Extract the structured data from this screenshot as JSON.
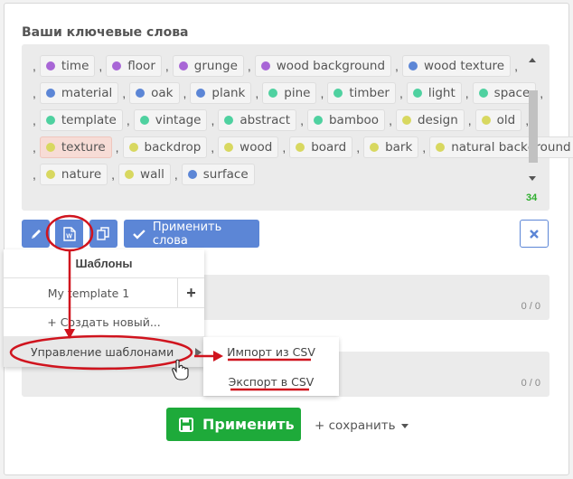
{
  "keywords_title": "Ваши ключевые слова",
  "keyword_lines": [
    [
      {
        "t": "time",
        "c": "#a866d6"
      },
      {
        "t": "floor",
        "c": "#a866d6"
      },
      {
        "t": "grunge",
        "c": "#a866d6"
      },
      {
        "t": "wood background",
        "c": "#a866d6"
      },
      {
        "t": "wood texture",
        "c": "#5c86d6"
      }
    ],
    [
      {
        "t": "material",
        "c": "#5c86d6"
      },
      {
        "t": "oak",
        "c": "#5c86d6"
      },
      {
        "t": "plank",
        "c": "#5c86d6"
      },
      {
        "t": "pine",
        "c": "#4fd1a0"
      },
      {
        "t": "timber",
        "c": "#4fd1a0"
      },
      {
        "t": "light",
        "c": "#4fd1a0"
      },
      {
        "t": "space",
        "c": "#4fd1a0"
      }
    ],
    [
      {
        "t": "template",
        "c": "#4fd1a0"
      },
      {
        "t": "vintage",
        "c": "#4fd1a0"
      },
      {
        "t": "abstract",
        "c": "#4fd1a0"
      },
      {
        "t": "bamboo",
        "c": "#4fd1a0"
      },
      {
        "t": "design",
        "c": "#d8d860"
      },
      {
        "t": "old",
        "c": "#d8d860"
      }
    ],
    [
      {
        "t": "texture",
        "c": "#d8d860",
        "hl": true
      },
      {
        "t": "backdrop",
        "c": "#d8d860"
      },
      {
        "t": "wood",
        "c": "#d8d860"
      },
      {
        "t": "board",
        "c": "#d8d860"
      },
      {
        "t": "bark",
        "c": "#d8d860"
      },
      {
        "t": "natural background",
        "c": "#d8d860"
      }
    ],
    [
      {
        "t": "nature",
        "c": "#d8d860"
      },
      {
        "t": "wall",
        "c": "#d8d860"
      },
      {
        "t": "surface",
        "c": "#5c86d6"
      }
    ]
  ],
  "keyword_count": "34",
  "toolbar": {
    "apply_words_label": "Применить слова",
    "icons": [
      "pencil-icon",
      "word-doc-icon",
      "copy-icon",
      "check-icon",
      "close-icon"
    ]
  },
  "templates_menu": {
    "header": "Шаблоны",
    "items": [
      "My template 1"
    ],
    "create_new": "+ Создать новый...",
    "manage": "Управление шаблонами"
  },
  "manage_submenu": {
    "import_csv": "Импорт из CSV",
    "export_csv": "Экспорт в CSV"
  },
  "fields": [
    {
      "count": "0 / 0"
    },
    {
      "count": "0 / 0"
    }
  ],
  "apply_button": "Применить",
  "save_link": "+ сохранить",
  "colors": {
    "accent_blue": "#5c86d6",
    "apply_green": "#1eaa3a",
    "count_green": "#2eae2e",
    "annotation_red": "#d0141e"
  }
}
